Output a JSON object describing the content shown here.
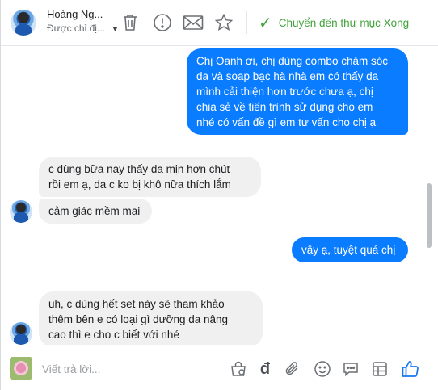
{
  "header": {
    "contact_name": "Hoàng Ng...",
    "contact_status": "Được chỉ đị...",
    "move_to_done_label": "Chuyển đến thư mục Xong",
    "icons": [
      "trash-icon",
      "spam-icon",
      "mark-unread-icon",
      "star-icon"
    ]
  },
  "messages": [
    {
      "from": "me",
      "text": "Chị Oanh ơi, chị dùng combo chăm sóc\nda và soap bạc hà nhà em có thấy da\nmình cải thiện hơn trước chưa ạ, chị\nchia sẻ về tiến trình sử dụng cho em\nnhé có vấn đề gì em tư vấn cho chị ạ"
    },
    {
      "from": "them",
      "text": "c dùng bữa nay thấy da mịn hơn chút\nrồi em ạ, da c ko bị khô nữa thích lắm"
    },
    {
      "from": "them",
      "text": "cảm giác mềm mại"
    },
    {
      "from": "me",
      "text": "vậy ạ, tuyệt quá chị"
    },
    {
      "from": "them",
      "text": "uh, c dùng hết set này sẽ tham khảo\nthêm bên e có loại gì dưỡng da nâng\ncao thì e cho c biết với nhé"
    }
  ],
  "composer": {
    "placeholder": "Viết trả lời...",
    "icons": [
      "shop-bag-icon",
      "dong-currency-icon",
      "attachment-icon",
      "emoji-icon",
      "saved-reply-icon",
      "template-grid-icon",
      "like-icon"
    ],
    "currency_symbol": "đ"
  },
  "colors": {
    "accent": "#0a7cff",
    "done_green": "#42a33b",
    "incoming_bubble": "#f0f0f0",
    "like_blue": "#1877f2"
  }
}
